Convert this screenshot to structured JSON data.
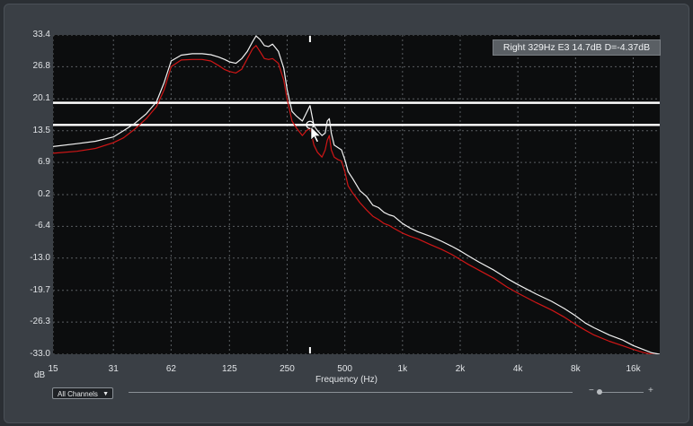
{
  "readout": "Right 329Hz E3 14.7dB D=-4.37dB",
  "controls": {
    "channels_label": "All Channels",
    "channels_arrow": "▼",
    "zoom_minus": "−",
    "zoom_plus": "+"
  },
  "colors": {
    "plot_bg": "#0c0d0e",
    "grid": "#5a5e62",
    "white_series": "#f2f2f2",
    "red_series": "#d01616",
    "band_line": "#ffffff"
  },
  "chart_data": {
    "type": "line",
    "xlabel": "Frequency (Hz)",
    "ylabel": "dB",
    "x_scale": "log",
    "xlim": [
      15,
      22000
    ],
    "ylim": [
      -33.0,
      33.4
    ],
    "grid": true,
    "x_ticks": [
      {
        "value": 15,
        "label": "15"
      },
      {
        "value": 31,
        "label": "31"
      },
      {
        "value": 62,
        "label": "62"
      },
      {
        "value": 125,
        "label": "125"
      },
      {
        "value": 250,
        "label": "250"
      },
      {
        "value": 500,
        "label": "500"
      },
      {
        "value": 1000,
        "label": "1k"
      },
      {
        "value": 2000,
        "label": "2k"
      },
      {
        "value": 4000,
        "label": "4k"
      },
      {
        "value": 8000,
        "label": "8k"
      },
      {
        "value": 16000,
        "label": "16k"
      }
    ],
    "y_ticks": [
      {
        "value": 33.4,
        "label": "33.4"
      },
      {
        "value": 26.8,
        "label": "26.8"
      },
      {
        "value": 20.1,
        "label": "20.1"
      },
      {
        "value": 13.5,
        "label": "13.5"
      },
      {
        "value": 6.9,
        "label": "6.9"
      },
      {
        "value": 0.2,
        "label": "0.2"
      },
      {
        "value": -6.4,
        "label": "-6.4"
      },
      {
        "value": -13.0,
        "label": "-13.0"
      },
      {
        "value": -19.7,
        "label": "-19.7"
      },
      {
        "value": -26.3,
        "label": "-26.3"
      },
      {
        "value": -33.0,
        "label": "-33.0"
      }
    ],
    "band_levels": [
      19.3,
      14.7
    ],
    "marker": {
      "x": 329,
      "y": 14.7
    },
    "series": [
      {
        "color": "#f2f2f2",
        "x": [
          15,
          20,
          25,
          31,
          35,
          40,
          46,
          52,
          57,
          62,
          70,
          80,
          90,
          100,
          110,
          118,
          125,
          135,
          145,
          155,
          165,
          172,
          180,
          190,
          200,
          210,
          225,
          240,
          250,
          265,
          280,
          300,
          315,
          329,
          345,
          360,
          380,
          395,
          405,
          415,
          425,
          440,
          460,
          480,
          500,
          520,
          550,
          600,
          650,
          700,
          750,
          800,
          850,
          900,
          1000,
          1100,
          1200,
          1400,
          1600,
          1800,
          2000,
          2200,
          2500,
          3000,
          3500,
          4000,
          5000,
          6000,
          7000,
          8000,
          9000,
          10000,
          12000,
          14000,
          16000,
          18000,
          20000,
          22000
        ],
        "y": [
          10.2,
          10.8,
          11.3,
          12.2,
          13.5,
          15.0,
          17.0,
          19.5,
          23.5,
          28.0,
          29.2,
          29.5,
          29.5,
          29.3,
          28.8,
          28.3,
          27.8,
          27.5,
          28.5,
          30.0,
          32.0,
          33.2,
          32.5,
          31.2,
          31.0,
          31.5,
          30.0,
          26.5,
          22.0,
          17.5,
          16.5,
          15.5,
          17.2,
          18.7,
          14.5,
          13.5,
          12.5,
          13.0,
          15.5,
          16.0,
          13.0,
          10.5,
          10.0,
          9.5,
          7.5,
          5.0,
          3.5,
          1.0,
          -0.2,
          -2.0,
          -2.5,
          -3.5,
          -4.0,
          -4.3,
          -5.8,
          -6.8,
          -7.5,
          -8.5,
          -9.5,
          -10.5,
          -11.5,
          -12.5,
          -13.8,
          -15.5,
          -17.2,
          -18.5,
          -20.5,
          -22.0,
          -23.5,
          -25.0,
          -26.5,
          -27.5,
          -29.0,
          -30.0,
          -31.2,
          -32.0,
          -32.7,
          -33.0
        ]
      },
      {
        "color": "#d01616",
        "x": [
          15,
          20,
          25,
          31,
          35,
          40,
          46,
          52,
          57,
          62,
          70,
          80,
          90,
          100,
          110,
          118,
          125,
          135,
          145,
          155,
          165,
          172,
          180,
          190,
          200,
          210,
          225,
          240,
          250,
          265,
          280,
          300,
          315,
          329,
          345,
          360,
          380,
          395,
          405,
          415,
          425,
          440,
          460,
          480,
          500,
          520,
          550,
          600,
          650,
          700,
          750,
          800,
          850,
          900,
          1000,
          1100,
          1200,
          1400,
          1600,
          1800,
          2000,
          2200,
          2500,
          3000,
          3500,
          4000,
          5000,
          6000,
          7000,
          8000,
          9000,
          10000,
          12000,
          14000,
          16000,
          18000,
          20000,
          22000
        ],
        "y": [
          8.8,
          9.2,
          9.8,
          11.0,
          12.0,
          13.8,
          16.0,
          18.5,
          22.0,
          26.8,
          28.2,
          28.3,
          28.3,
          28.0,
          27.0,
          26.2,
          25.8,
          25.5,
          26.3,
          28.5,
          30.5,
          31.2,
          30.0,
          28.5,
          28.3,
          28.5,
          27.5,
          24.0,
          20.0,
          15.5,
          14.0,
          12.5,
          13.5,
          14.0,
          10.5,
          9.0,
          8.0,
          9.5,
          11.5,
          12.5,
          9.5,
          8.0,
          7.5,
          7.2,
          5.0,
          2.0,
          0.5,
          -1.5,
          -3.0,
          -4.3,
          -5.0,
          -5.8,
          -6.2,
          -6.8,
          -7.8,
          -8.5,
          -9.0,
          -10.2,
          -11.2,
          -12.2,
          -13.3,
          -14.3,
          -15.5,
          -17.2,
          -19.0,
          -20.3,
          -22.3,
          -23.8,
          -25.3,
          -26.8,
          -28.0,
          -29.0,
          -30.3,
          -31.2,
          -32.0,
          -32.6,
          -33.0,
          -33.2
        ]
      }
    ]
  }
}
